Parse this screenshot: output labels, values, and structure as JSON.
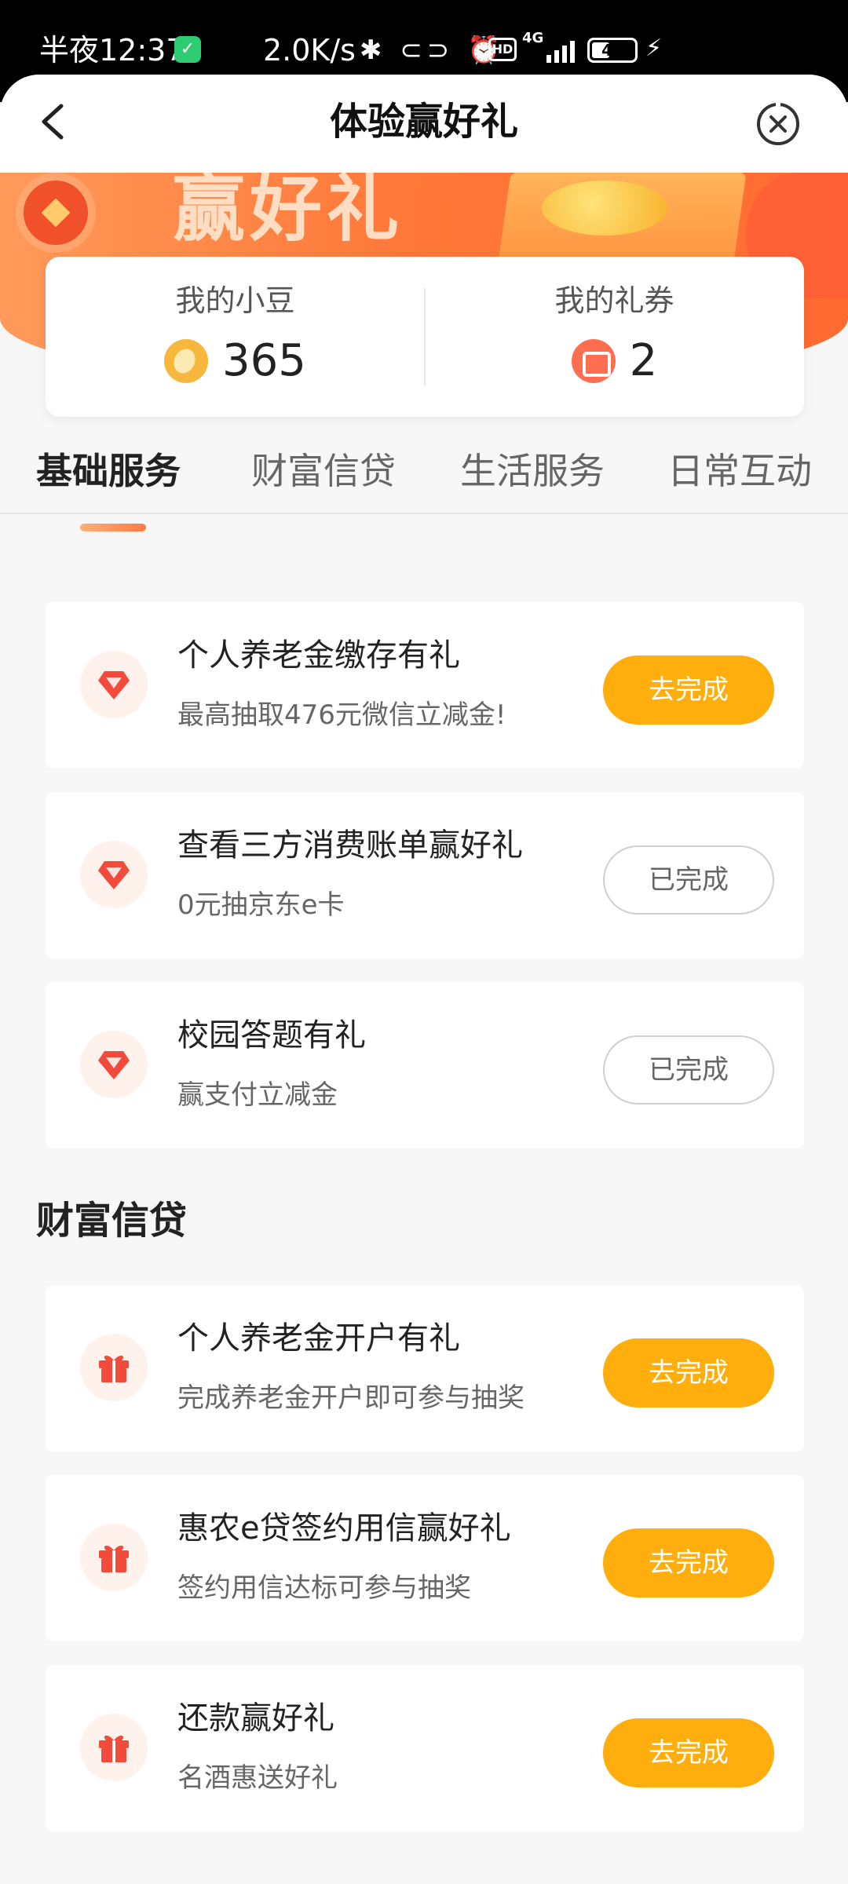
{
  "status_bar": {
    "time": "半夜12:37",
    "net_speed": "2.0K/s",
    "network": "4G",
    "battery": "42",
    "battery_level": 0.42
  },
  "header": {
    "title": "体验赢好礼"
  },
  "stats": {
    "beans_label": "我的小豆",
    "beans_value": "365",
    "coupons_label": "我的礼券",
    "coupons_value": "2"
  },
  "tabs": [
    {
      "label": "基础服务",
      "active": true
    },
    {
      "label": "财富信贷",
      "active": false
    },
    {
      "label": "生活服务",
      "active": false
    },
    {
      "label": "日常互动",
      "active": false
    }
  ],
  "basic_tasks": [
    {
      "icon": "diamond-icon",
      "title": "个人养老金缴存有礼",
      "subtitle": "最高抽取476元微信立减金!",
      "button": "去完成",
      "status": "todo"
    },
    {
      "icon": "diamond-icon",
      "title": "查看三方消费账单赢好礼",
      "subtitle": "0元抽京东e卡",
      "button": "已完成",
      "status": "done"
    },
    {
      "icon": "diamond-icon",
      "title": "校园答题有礼",
      "subtitle": "赢支付立减金",
      "button": "已完成",
      "status": "done"
    }
  ],
  "wealth_section": {
    "title": "财富信贷"
  },
  "wealth_tasks": [
    {
      "icon": "gift-icon",
      "title": "个人养老金开户有礼",
      "subtitle": "完成养老金开户即可参与抽奖",
      "button": "去完成",
      "status": "todo"
    },
    {
      "icon": "gift-icon",
      "title": "惠农e贷签约用信赢好礼",
      "subtitle": "签约用信达标可参与抽奖",
      "button": "去完成",
      "status": "todo"
    },
    {
      "icon": "gift-icon",
      "title": "还款赢好礼",
      "subtitle": "名酒惠送好礼",
      "button": "去完成",
      "status": "todo"
    }
  ],
  "colors": {
    "accent": "#ffae0d",
    "banner": "#ff7a3a",
    "icon_red": "#f24b3c"
  }
}
